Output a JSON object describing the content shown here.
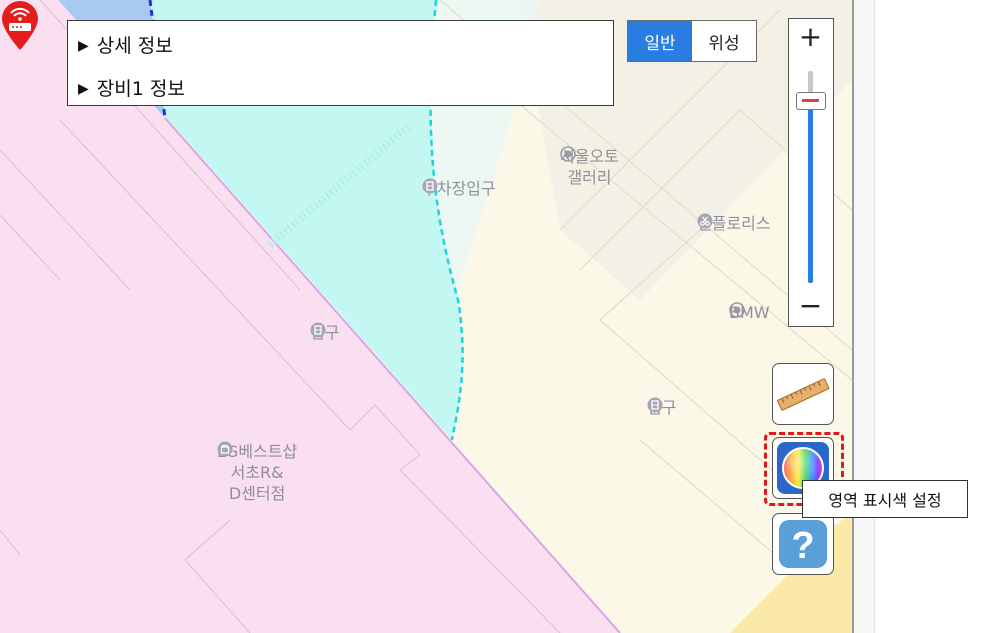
{
  "info_panel": {
    "rows": [
      {
        "arrow": "▶",
        "label": "상세 정보"
      },
      {
        "arrow": "▶",
        "label": "장비1 정보"
      }
    ]
  },
  "map_type": {
    "options": [
      "일반",
      "위성"
    ],
    "selected": "일반"
  },
  "zoom": {
    "plus": "+",
    "minus": "−",
    "level_fraction": 0.83
  },
  "pois": [
    {
      "name": "서울오토\n갤러리",
      "line1": "서울오토",
      "line2": "갤러리",
      "icon": "target-icon"
    },
    {
      "name": "주차장입구",
      "line1": "주차장입구",
      "icon": "entrance-icon"
    },
    {
      "name": "엘플로리스",
      "line1": "엘플로리스",
      "icon": "scissors-icon"
    },
    {
      "name": "BMW",
      "line1": "BMW",
      "icon": "target-icon"
    },
    {
      "name": "입구",
      "line1": "입구",
      "icon": "entrance-icon"
    },
    {
      "name": "입구",
      "line1": "입구",
      "icon": "entrance-icon"
    },
    {
      "name": "LG베스트샵 서초R&D센터점",
      "line1": "LG베스트샵",
      "line2": "서초R&",
      "line3": "D센터점",
      "icon": "shop-icon"
    }
  ],
  "tools": {
    "ruler_icon": "ruler-icon",
    "color_icon": "color-wheel-icon",
    "help_icon": "question-icon",
    "help_label": "?"
  },
  "tooltip": {
    "text": "영역 표시색 설정"
  },
  "colors": {
    "accent": "#2a7de1",
    "highlight": "#e01818",
    "pink_zone": "#f9dff0",
    "cyan_zone": "#c2f7f2",
    "map_bg": "#fbf8e8"
  }
}
